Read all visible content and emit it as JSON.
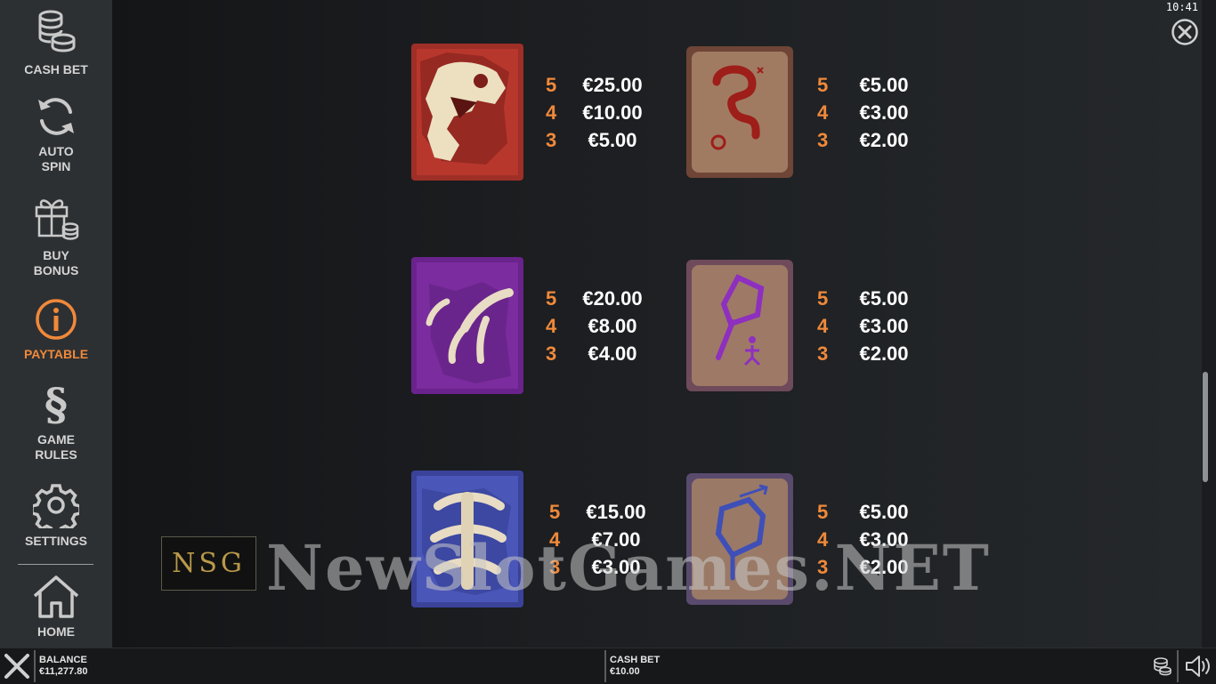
{
  "sidebar": {
    "items": [
      {
        "label_1": "CASH BET",
        "label_2": "",
        "icon": "coins-stack-icon"
      },
      {
        "label_1": "AUTO",
        "label_2": "SPIN",
        "icon": "refresh-icon"
      },
      {
        "label_1": "BUY",
        "label_2": "BONUS",
        "icon": "gift-coins-icon"
      },
      {
        "label_1": "PAYTABLE",
        "label_2": "",
        "icon": "info-icon",
        "active": true
      },
      {
        "label_1": "GAME",
        "label_2": "RULES",
        "icon": "section-sign-icon"
      },
      {
        "label_1": "SETTINGS",
        "label_2": "",
        "icon": "gear-icon"
      },
      {
        "label_1": "HOME",
        "label_2": "",
        "icon": "home-icon"
      }
    ]
  },
  "clock": "10:41",
  "colors": {
    "accent": "#f0893a",
    "sidebar": "#2d3033",
    "background": "#1a1c1f"
  },
  "paytable": {
    "symbols": [
      {
        "name": "dinosaur-skull",
        "tile_color": "#b8372d",
        "pays": [
          {
            "count": "5",
            "amount": "€25.00"
          },
          {
            "count": "4",
            "amount": "€10.00"
          },
          {
            "count": "3",
            "amount": "€5.00"
          }
        ]
      },
      {
        "name": "red-cave-painting",
        "tile_color": "#8a5a45",
        "pays": [
          {
            "count": "5",
            "amount": "€5.00"
          },
          {
            "count": "4",
            "amount": "€3.00"
          },
          {
            "count": "3",
            "amount": "€2.00"
          }
        ]
      },
      {
        "name": "claw",
        "tile_color": "#7b2c9e",
        "pays": [
          {
            "count": "5",
            "amount": "€20.00"
          },
          {
            "count": "4",
            "amount": "€8.00"
          },
          {
            "count": "3",
            "amount": "€4.00"
          }
        ]
      },
      {
        "name": "purple-cave-painting",
        "tile_color": "#8a6a5a",
        "pays": [
          {
            "count": "5",
            "amount": "€5.00"
          },
          {
            "count": "4",
            "amount": "€3.00"
          },
          {
            "count": "3",
            "amount": "€2.00"
          }
        ]
      },
      {
        "name": "spine-bones",
        "tile_color": "#3f49a8",
        "pays": [
          {
            "count": "5",
            "amount": "€15.00"
          },
          {
            "count": "4",
            "amount": "€7.00"
          },
          {
            "count": "3",
            "amount": "€3.00"
          }
        ]
      },
      {
        "name": "blue-cave-painting",
        "tile_color": "#8a6a5a",
        "pays": [
          {
            "count": "5",
            "amount": "€5.00"
          },
          {
            "count": "4",
            "amount": "€3.00"
          },
          {
            "count": "3",
            "amount": "€2.00"
          }
        ]
      }
    ]
  },
  "watermark": {
    "logo": "NSG",
    "text": "NewSlotGames.NET"
  },
  "bottom_bar": {
    "balance_label": "BALANCE",
    "balance_value": "€11,277.80",
    "cash_bet_label": "CASH BET",
    "cash_bet_value": "€10.00"
  }
}
